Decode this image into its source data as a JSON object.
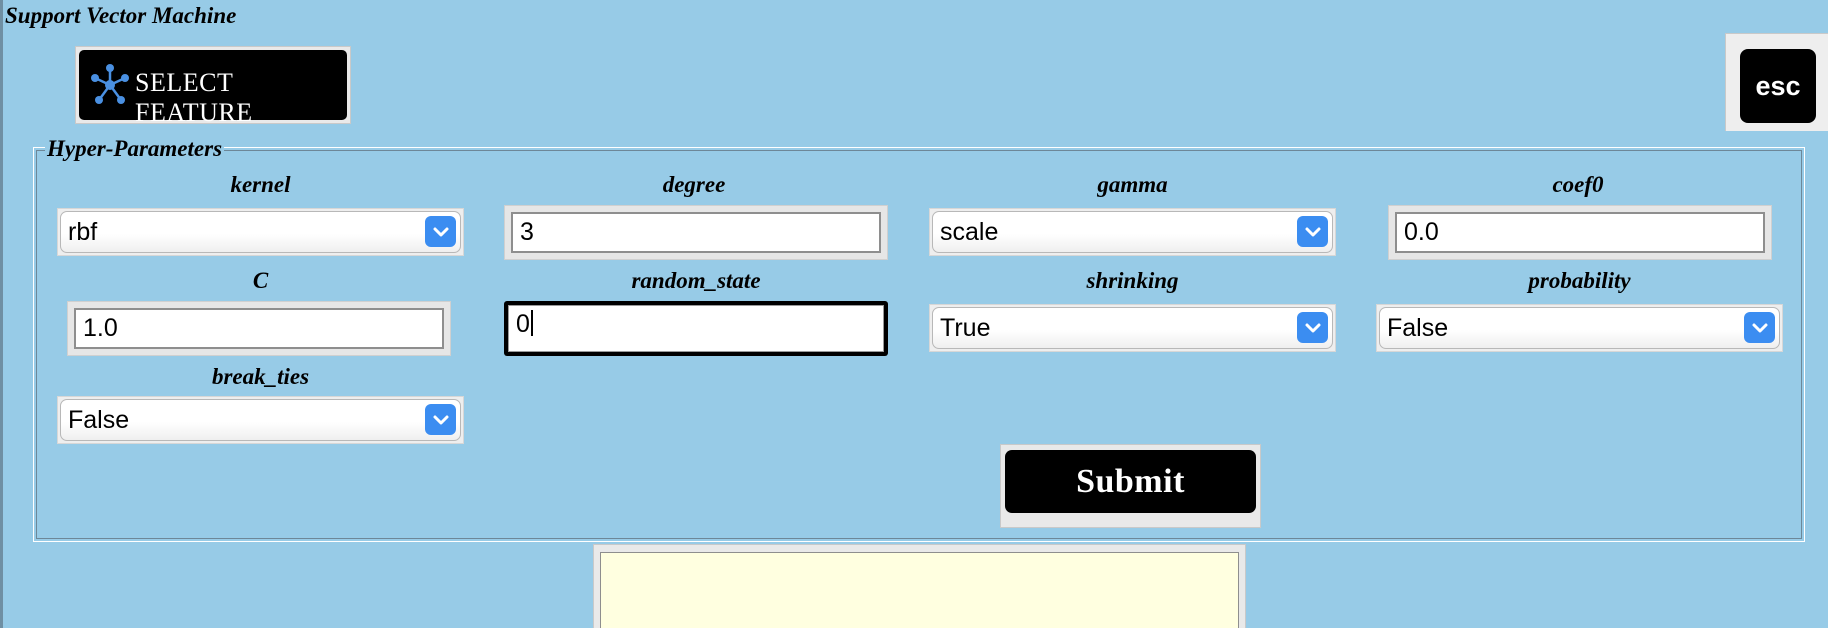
{
  "window": {
    "title": "Support Vector Machine"
  },
  "toolbar": {
    "select_feature_label": "SELECT FEATURE",
    "esc_label": "esc"
  },
  "hyper_parameters": {
    "legend": "Hyper-Parameters",
    "kernel": {
      "label": "kernel",
      "value": "rbf"
    },
    "degree": {
      "label": "degree",
      "value": "3"
    },
    "gamma": {
      "label": "gamma",
      "value": "scale"
    },
    "coef0": {
      "label": "coef0",
      "value": "0.0"
    },
    "C": {
      "label": "C",
      "value": "1.0"
    },
    "random_state": {
      "label": "random_state",
      "value": "0"
    },
    "shrinking": {
      "label": "shrinking",
      "value": "True"
    },
    "probability": {
      "label": "probability",
      "value": "False"
    },
    "break_ties": {
      "label": "break_ties",
      "value": "False"
    }
  },
  "actions": {
    "submit_label": "Submit"
  },
  "colors": {
    "background": "#97cbe7",
    "button_black": "#000000",
    "dropdown_arrow_blue": "#3b8df1",
    "output_background": "#ffffe0"
  },
  "icons": {
    "select_feature": "network-icon",
    "dropdown": "chevron-down-icon"
  }
}
